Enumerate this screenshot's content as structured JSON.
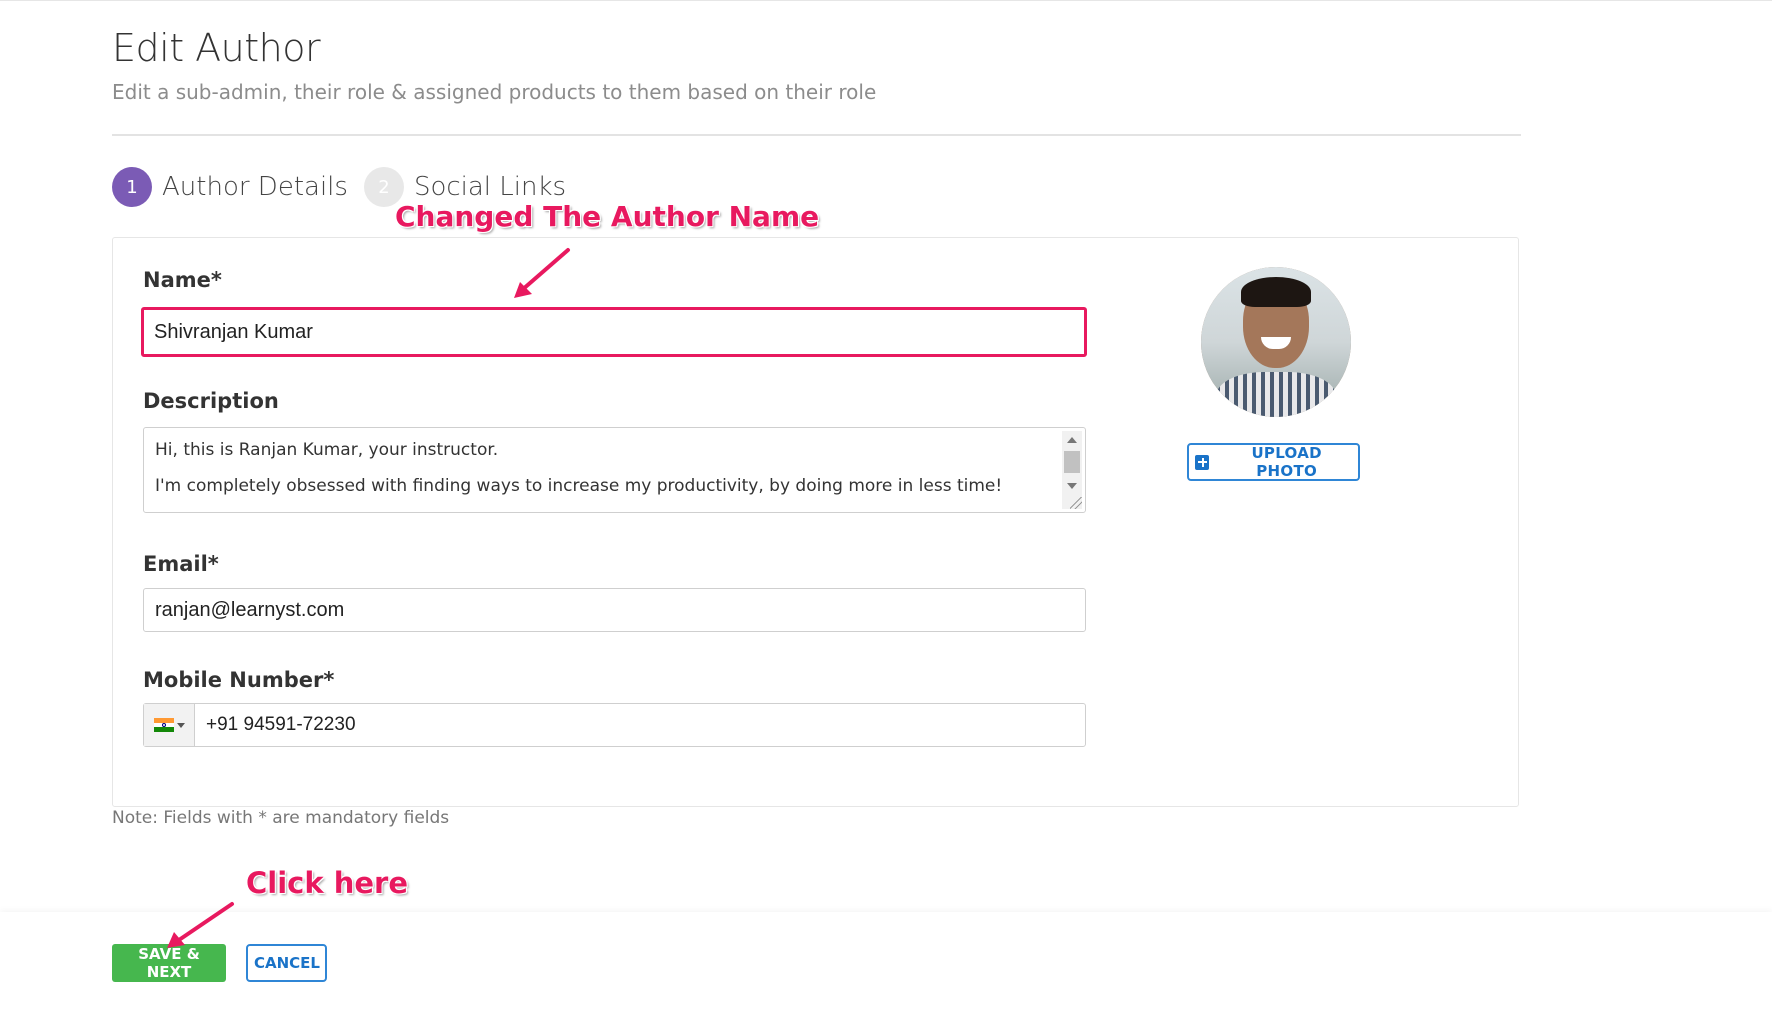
{
  "page": {
    "title": "Edit Author",
    "subtitle": "Edit a sub-admin, their role & assigned products to them based on their role"
  },
  "stepper": {
    "steps": [
      {
        "number": "1",
        "label": "Author Details",
        "active": true
      },
      {
        "number": "2",
        "label": "Social Links",
        "active": false
      }
    ]
  },
  "form": {
    "name": {
      "label": "Name*",
      "value": "Shivranjan Kumar"
    },
    "description": {
      "label": "Description",
      "lines": [
        "Hi, this is Ranjan Kumar, your instructor.",
        "I'm completely obsessed with finding ways to increase my productivity, by doing more in less time!"
      ]
    },
    "email": {
      "label": "Email*",
      "value": "ranjan@learnyst.com"
    },
    "mobile": {
      "label": "Mobile Number*",
      "country_flag": "india-flag-icon",
      "value": "+91 94591-72230"
    },
    "upload_photo_label": "UPLOAD PHOTO",
    "note": "Note: Fields with * are mandatory fields"
  },
  "footer": {
    "save_label": "SAVE & NEXT",
    "cancel_label": "CANCEL"
  },
  "annotations": {
    "name_changed": "Changed The Author Name",
    "click_here": "Click here"
  },
  "colors": {
    "accent_purple": "#7b5bb5",
    "highlight_pink": "#e8195f",
    "save_green": "#46b74e",
    "link_blue": "#1a73c8"
  }
}
